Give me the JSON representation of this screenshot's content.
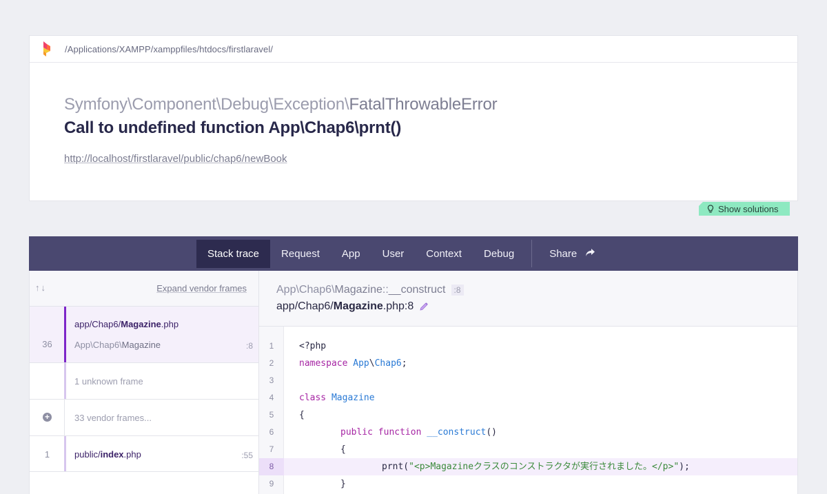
{
  "header": {
    "path": "/Applications/XAMPP/xamppfiles/htdocs/firstlaravel/",
    "exception_namespace": "Symfony\\Component\\Debug\\Exception\\",
    "exception_class": "FatalThrowableError",
    "message": "Call to undefined function App\\Chap6\\prnt()",
    "url": "http://localhost/firstlaravel/public/chap6/newBook"
  },
  "solutions_button": "Show solutions",
  "tabs": [
    {
      "label": "Stack trace",
      "active": true
    },
    {
      "label": "Request"
    },
    {
      "label": "App"
    },
    {
      "label": "User"
    },
    {
      "label": "Context"
    },
    {
      "label": "Debug"
    }
  ],
  "share_label": "Share",
  "frames_panel": {
    "arrows": "↑↓",
    "expand_label": "Expand vendor frames",
    "frames": [
      {
        "number": "36",
        "file_prefix": "app/Chap6/",
        "file_name": "Magazine",
        "file_ext": ".php",
        "class_prefix": "App\\Chap6\\",
        "class_name": "Magazine",
        "line": ":8"
      },
      {
        "text": "1 unknown frame"
      },
      {
        "text": "33 vendor frames..."
      },
      {
        "number": "1",
        "file_prefix": "public/",
        "file_name": "index",
        "file_ext": ".php",
        "line": ":55"
      }
    ]
  },
  "detail": {
    "method_prefix": "App\\Chap6\\",
    "method_class": "Magazine",
    "method_sep": "::",
    "method_name": "__construct",
    "line_badge": ":8",
    "file_prefix": "app/Chap6/",
    "file_name": "Magazine",
    "file_suffix": ".php:8"
  },
  "code": {
    "highlight_line": 8,
    "lines": [
      {
        "n": "1"
      },
      {
        "n": "2"
      },
      {
        "n": "3"
      },
      {
        "n": "4"
      },
      {
        "n": "5"
      },
      {
        "n": "6"
      },
      {
        "n": "7"
      },
      {
        "n": "8"
      },
      {
        "n": "9"
      }
    ],
    "tokens": {
      "l1": "<?php",
      "l2_kw": "namespace",
      "l2_ns1": "App",
      "l2_sep": "\\",
      "l2_ns2": "Chap6",
      "l2_end": ";",
      "l4_kw": "class",
      "l4_name": "Magazine",
      "l5": "{",
      "l6_kw1": "public",
      "l6_kw2": "function",
      "l6_name": "__construct",
      "l6_end": "()",
      "l7": "{",
      "l8_fn": "prnt(",
      "l8_str": "\"<p>Magazineクラスのコンストラクタが実行されました。</p>\"",
      "l8_end": ");",
      "l9": "}"
    }
  },
  "colors": {
    "accent_purple": "#7d26c9",
    "tab_bar": "#4a4870",
    "solutions_green": "#8ee9c1"
  }
}
